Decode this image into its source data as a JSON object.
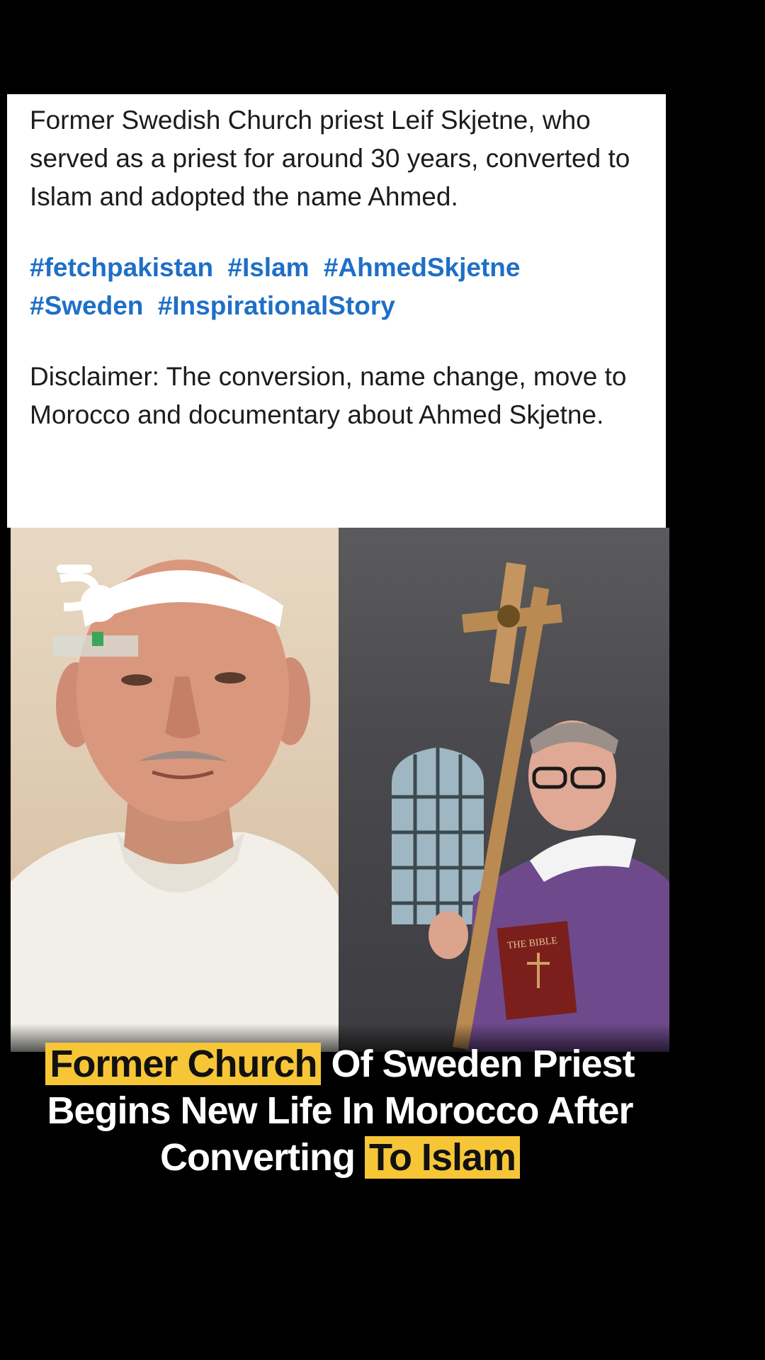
{
  "post": {
    "paragraph1": "Former Swedish Church priest Leif Skjetne, who served as a priest for around 30 years, converted to Islam and adopted the name Ahmed.",
    "hashtags": [
      "#fetchpakistan",
      "#Islam",
      "#AhmedSkjetne",
      "#Sweden",
      "#InspirationalStory"
    ],
    "disclaimer": "Disclaimer: The conversion, name change, move to Morocco and documentary about Ahmed Skjetne."
  },
  "image": {
    "bible_label": "THE BIBLE",
    "headline": {
      "highlight1": "Former Church",
      "middle": " Of Sweden Priest Begins New Life In Morocco After Converting ",
      "highlight2": "To Islam"
    }
  },
  "colors": {
    "hashtag": "#1e6fc7",
    "highlight": "#f6c637",
    "background": "#000000"
  },
  "icons": {
    "watermark": "channel-logo-icon"
  }
}
